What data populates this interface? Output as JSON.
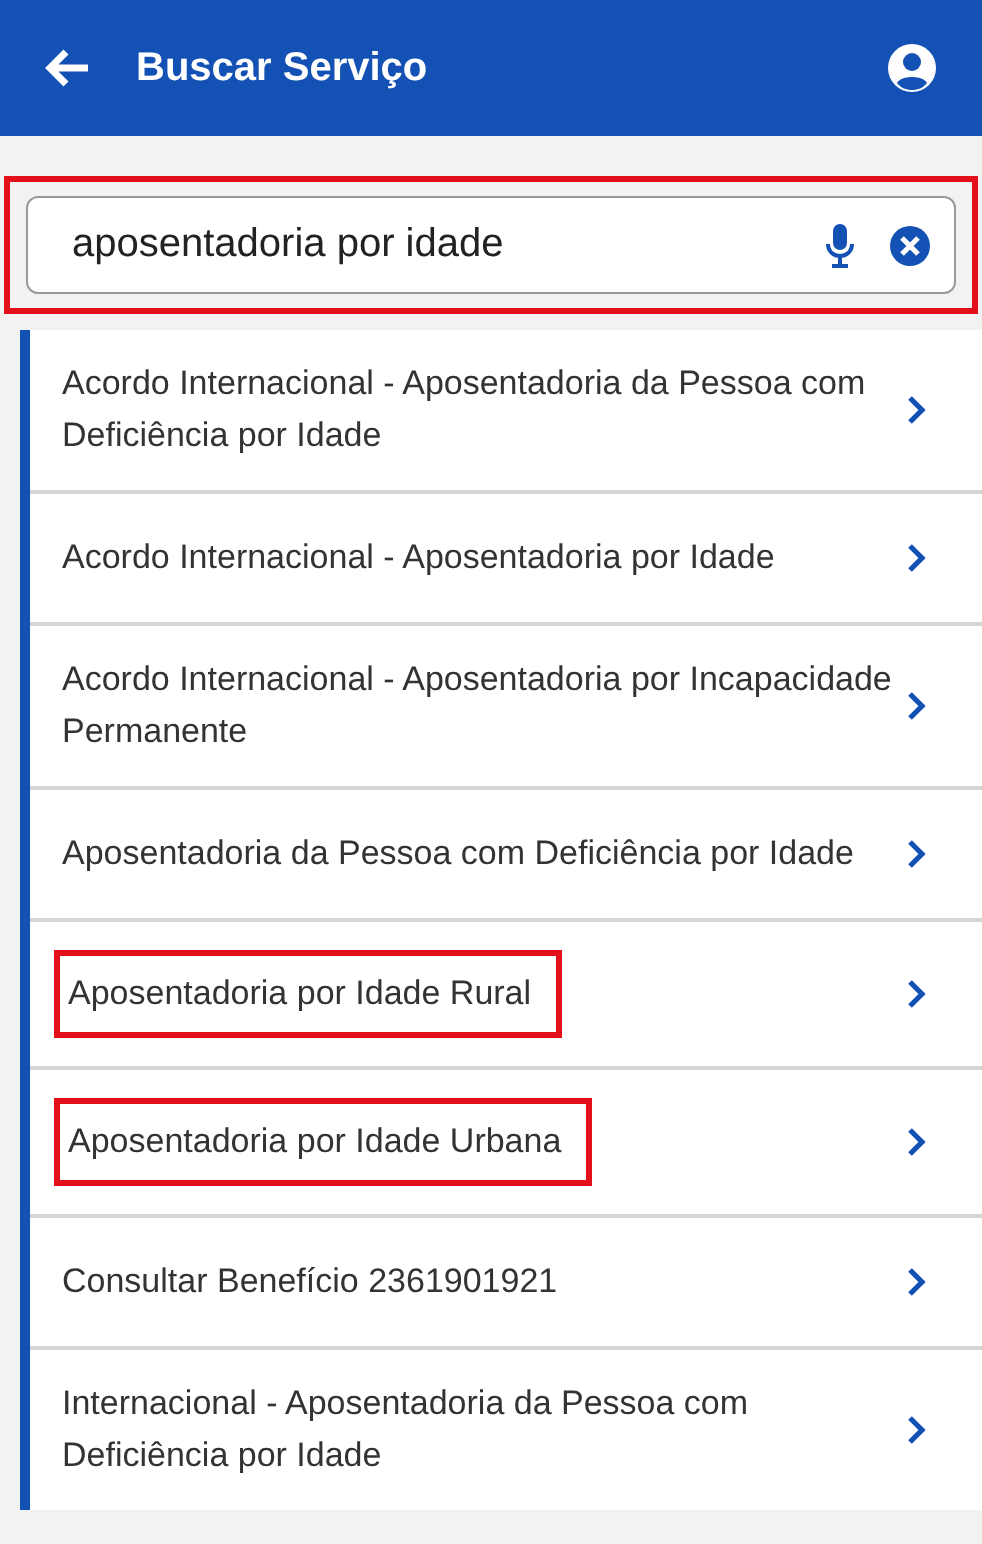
{
  "header": {
    "title": "Buscar Serviço"
  },
  "search": {
    "value": "aposentadoria por idade",
    "highlighted": true
  },
  "results": [
    {
      "label": "Acordo Internacional - Aposentadoria da Pessoa com Deficiência por Idade",
      "highlighted": false
    },
    {
      "label": "Acordo Internacional - Aposentadoria por Idade",
      "highlighted": false
    },
    {
      "label": "Acordo Internacional - Aposentadoria por Incapacidade Permanente",
      "highlighted": false
    },
    {
      "label": "Aposentadoria da Pessoa com Deficiência por Idade",
      "highlighted": false
    },
    {
      "label": "Aposentadoria por Idade Rural",
      "highlighted": true
    },
    {
      "label": "Aposentadoria por Idade Urbana",
      "highlighted": true
    },
    {
      "label": "Consultar Benefício 2361901921",
      "highlighted": false
    },
    {
      "label": "Internacional - Aposentadoria da Pessoa com Deficiência por Idade",
      "highlighted": false
    }
  ]
}
